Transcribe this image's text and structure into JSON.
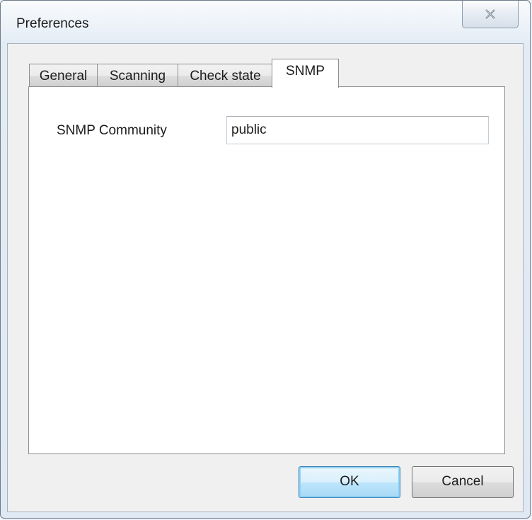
{
  "window": {
    "title": "Preferences",
    "close_icon": "close-icon"
  },
  "tabs": [
    {
      "label": "General",
      "active": false
    },
    {
      "label": "Scanning",
      "active": false
    },
    {
      "label": "Check state",
      "active": false
    },
    {
      "label": "SNMP",
      "active": true
    }
  ],
  "snmp": {
    "community_label": "SNMP Community",
    "community_value": "public"
  },
  "buttons": {
    "ok_label": "OK",
    "cancel_label": "Cancel"
  },
  "colors": {
    "default_button_accent": "#3c7fb1",
    "panel_background": "#ffffff",
    "dialog_background": "#f0f0f0"
  }
}
